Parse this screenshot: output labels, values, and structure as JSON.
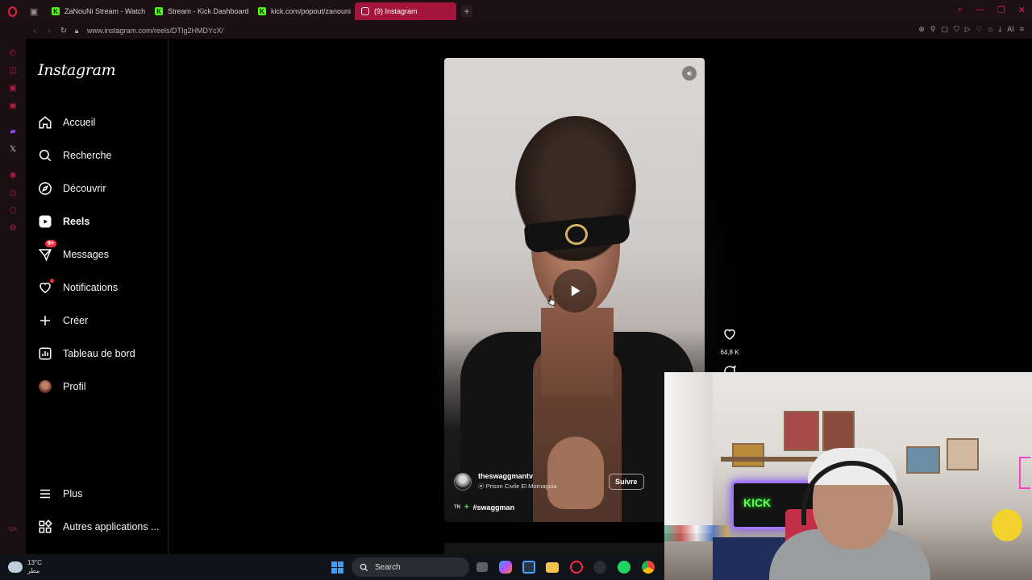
{
  "browser": {
    "tabs": [
      {
        "label": "ZaNouNi Stream - Watch Live",
        "favicon": "kick-icon",
        "color": "#53fc18"
      },
      {
        "label": "Stream - Kick Dashboard",
        "favicon": "kick-icon",
        "color": "#53fc18"
      },
      {
        "label": "kick.com/popout/zanouni",
        "favicon": "kick-icon",
        "color": "#53fc18"
      },
      {
        "label": "(9) Instagram",
        "favicon": "instagram-icon",
        "color": "#e1306c",
        "active": true
      }
    ],
    "url": "www.instagram.com/reels/DTIg2HMDYcX/",
    "accent": "#e5223f"
  },
  "sidebar": {
    "logo": "Instagram",
    "items": [
      {
        "label": "Accueil",
        "icon": "home-icon"
      },
      {
        "label": "Recherche",
        "icon": "search-icon"
      },
      {
        "label": "Découvrir",
        "icon": "compass-icon"
      },
      {
        "label": "Reels",
        "icon": "reels-icon",
        "active": true
      },
      {
        "label": "Messages",
        "icon": "messenger-icon",
        "badge": "9+"
      },
      {
        "label": "Notifications",
        "icon": "heart-icon",
        "dot": true
      },
      {
        "label": "Créer",
        "icon": "plus-icon"
      },
      {
        "label": "Tableau de bord",
        "icon": "dashboard-icon"
      },
      {
        "label": "Profil",
        "icon": "avatar"
      }
    ],
    "bottom": [
      {
        "label": "Plus",
        "icon": "menu-icon"
      },
      {
        "label": "Autres applications ...",
        "icon": "apps-icon"
      }
    ]
  },
  "reel": {
    "username": "theswaggmantv",
    "location": "Prison Civile El Mornaguia",
    "follow_label": "Suivre",
    "caption_prefix": "TN",
    "caption": "#swaggman",
    "likes": "64,8 K"
  },
  "webcam": {
    "neon_sign": "KICK"
  },
  "taskbar": {
    "temperature": "13°C",
    "weather_text": "مطر",
    "search_label": "Search"
  }
}
